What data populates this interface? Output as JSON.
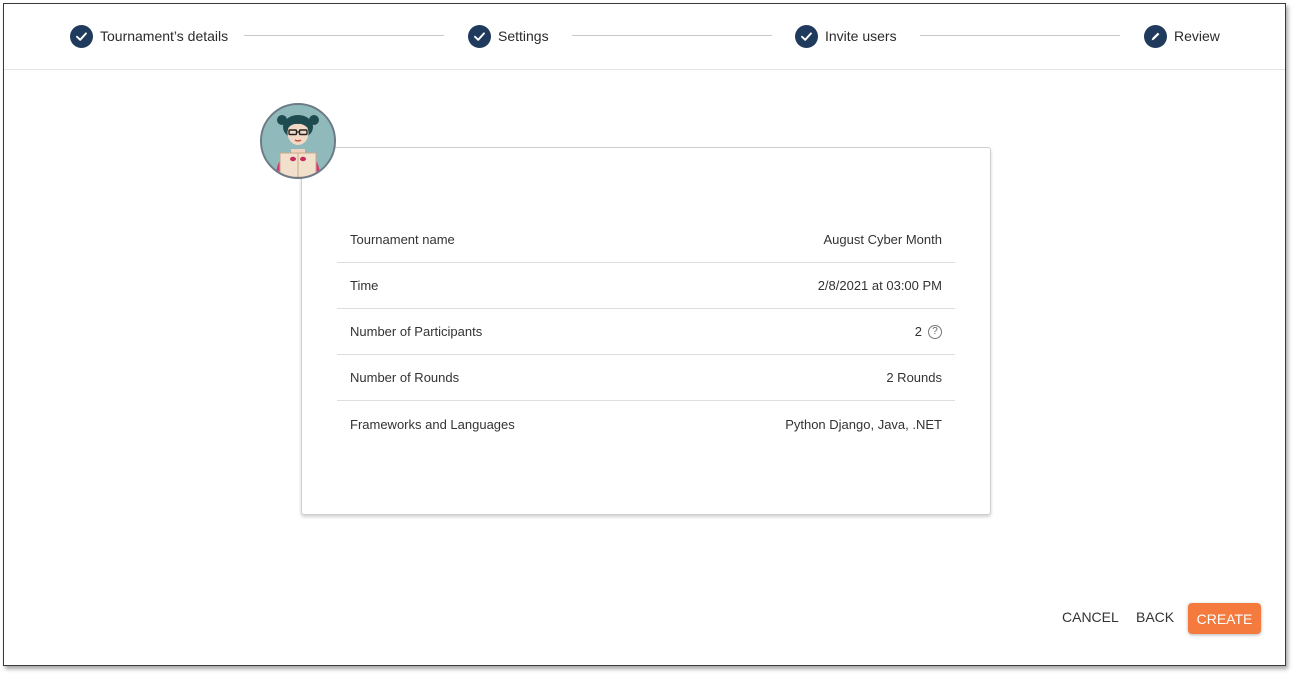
{
  "stepper": {
    "steps": [
      {
        "label": "Tournament’s details",
        "icon": "check-icon",
        "state": "completed"
      },
      {
        "label": "Settings",
        "icon": "check-icon",
        "state": "completed"
      },
      {
        "label": "Invite users",
        "icon": "check-icon",
        "state": "completed"
      },
      {
        "label": "Review",
        "icon": "pencil-icon",
        "state": "current"
      }
    ],
    "accent_color": "#1f3a5c"
  },
  "review": {
    "rows": [
      {
        "label": "Tournament name",
        "value": "August Cyber Month"
      },
      {
        "label": "Time",
        "value": "2/8/2021 at 03:00 PM"
      },
      {
        "label": "Number of Participants",
        "value": "2",
        "icon": "help-icon"
      },
      {
        "label": "Number of Rounds",
        "value": "2 Rounds"
      },
      {
        "label": "Frameworks and Languages",
        "value": "Python Django, Java, .NET"
      }
    ],
    "help_glyph": "?"
  },
  "footer": {
    "cancel_label": "CANCEL",
    "back_label": "BACK",
    "create_label": "CREATE",
    "create_color": "#f47a3e"
  }
}
